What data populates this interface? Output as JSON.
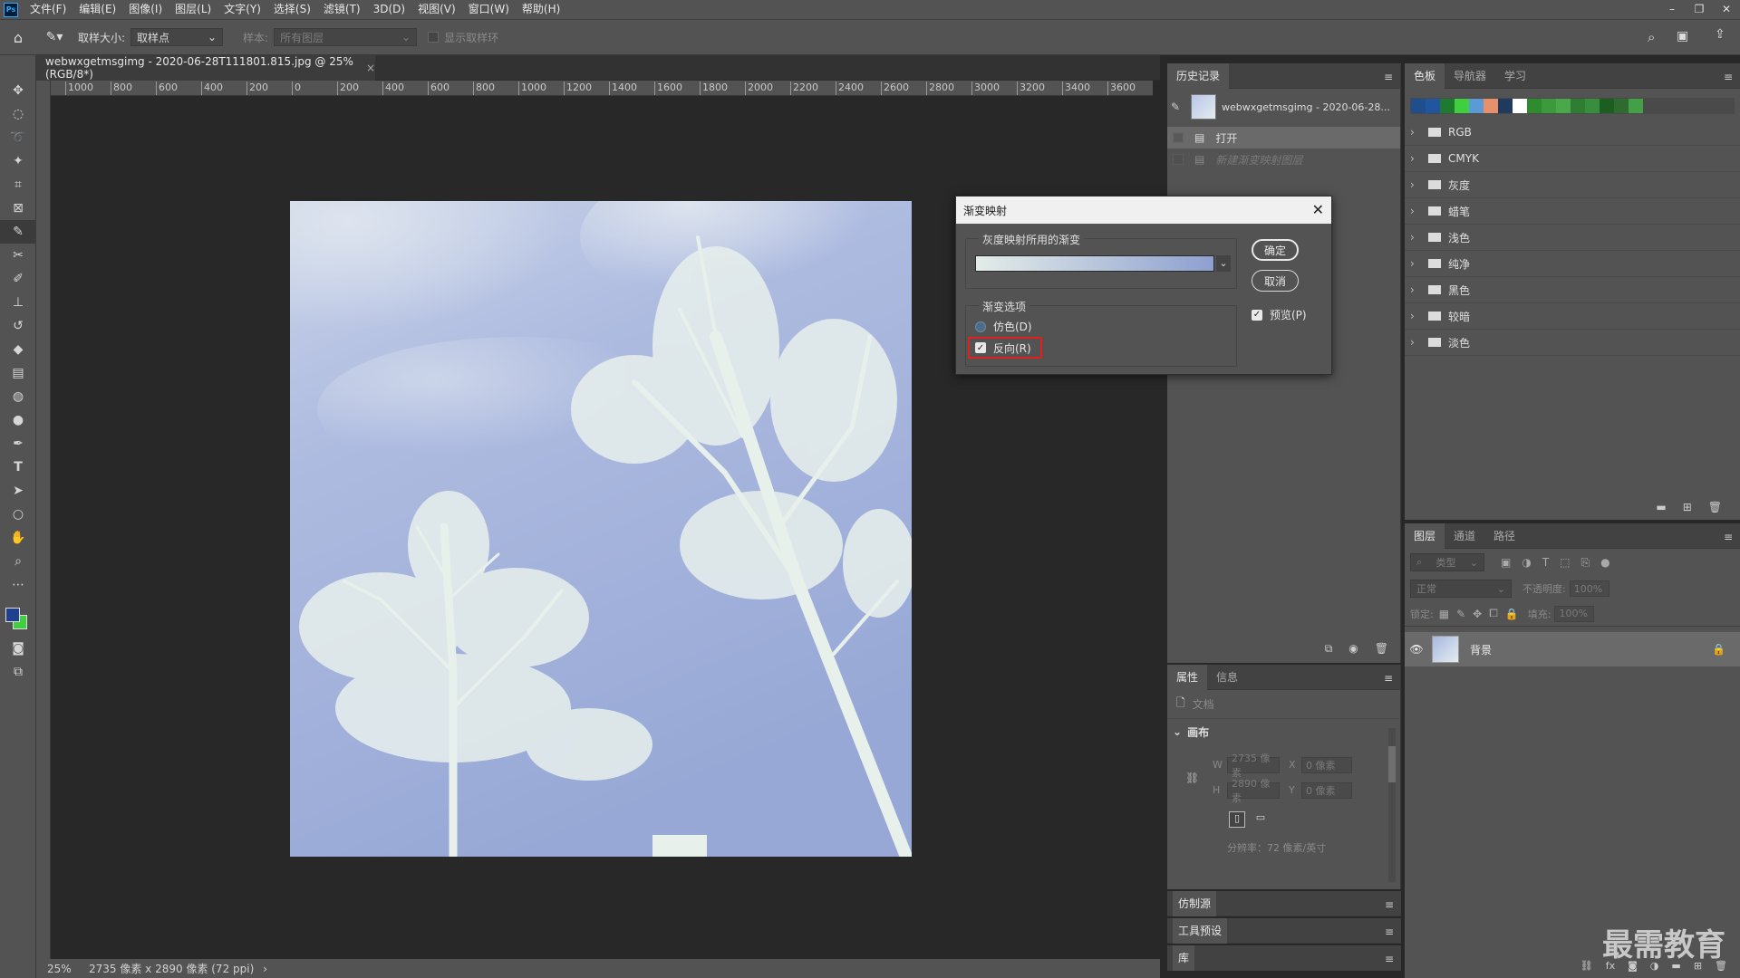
{
  "app": {
    "logo": "Ps",
    "menu": [
      "文件(F)",
      "编辑(E)",
      "图像(I)",
      "图层(L)",
      "文字(Y)",
      "选择(S)",
      "滤镜(T)",
      "3D(D)",
      "视图(V)",
      "窗口(W)",
      "帮助(H)"
    ],
    "window_buttons": [
      "–",
      "❐",
      "✕"
    ]
  },
  "options": {
    "sample_size_label": "取样大小:",
    "sample_size_value": "取样点",
    "sample_label": "样本:",
    "sample_value": "所有图层",
    "show_ring_label": "显示取样环"
  },
  "document": {
    "tab_title": "webwxgetmsgimg - 2020-06-28T111801.815.jpg @ 25%(RGB/8*)",
    "tab_close": "×",
    "ruler_ticks": [
      "1000",
      "800",
      "600",
      "400",
      "200",
      "0",
      "200",
      "400",
      "600",
      "800",
      "1000",
      "1200",
      "1400",
      "1600",
      "1800",
      "2000",
      "2200",
      "2400",
      "2600",
      "2800",
      "3000",
      "3200",
      "3400",
      "3600"
    ],
    "zoom": "25%",
    "size_info": "2735 像素 x 2890 像素 (72 ppi)",
    "status_arrow": "›"
  },
  "history": {
    "tabs": [
      "历史记录"
    ],
    "snapshot": "webwxgetmsgimg - 2020-06-28...",
    "items": [
      {
        "label": "打开",
        "state": "active"
      },
      {
        "label": "新建渐变映射图层",
        "state": "dimmed"
      }
    ]
  },
  "swatches": {
    "tabs": [
      "色板",
      "导航器",
      "学习"
    ],
    "colors": [
      "#1f4e8c",
      "#2255a0",
      "#1e7a2e",
      "#3fcf3f",
      "#5b9bd5",
      "#e8906a",
      "#1e3a5f",
      "#ffffff",
      "#2e8b2e",
      "#3c9a3c",
      "#4aa84a",
      "#2e7d32",
      "#388e3c",
      "#1b5e20",
      "#2f6b2f",
      "#43a047"
    ],
    "folders": [
      "RGB",
      "CMYK",
      "灰度",
      "蜡笔",
      "浅色",
      "纯净",
      "黑色",
      "较暗",
      "淡色"
    ]
  },
  "properties": {
    "tabs": [
      "属性",
      "信息"
    ],
    "doc_label": "文档",
    "section": "画布",
    "w_label": "W",
    "w_value": "2735 像素",
    "h_label": "H",
    "h_value": "2890 像素",
    "x_label": "X",
    "x_value": "0 像素",
    "y_label": "Y",
    "y_value": "0 像素",
    "resolution": "分辨率：72 像素/英寸"
  },
  "collapsed_panels": [
    "仿制源",
    "工具预设",
    "库"
  ],
  "layers": {
    "tabs": [
      "图层",
      "通道",
      "路径"
    ],
    "filter_placeholder": "类型",
    "blend_mode": "正常",
    "opacity_label": "不透明度:",
    "opacity_value": "100%",
    "lock_label": "锁定:",
    "fill_label": "填充:",
    "fill_value": "100%",
    "layer_name": "背景"
  },
  "dialog": {
    "title": "渐变映射",
    "group_gradient": "灰度映射所用的渐变",
    "group_options": "渐变选项",
    "dither_label": "仿色(D)",
    "reverse_label": "反向(R)",
    "ok_label": "确定",
    "cancel_label": "取消",
    "preview_label": "预览(P)",
    "gradient_start": "#e4ece8",
    "gradient_end": "#8da0cf",
    "highlight_color": "#e02020"
  },
  "watermark": "最需教育",
  "colors": {
    "fg": "#1f3f8f",
    "bg": "#3fcf3f"
  }
}
